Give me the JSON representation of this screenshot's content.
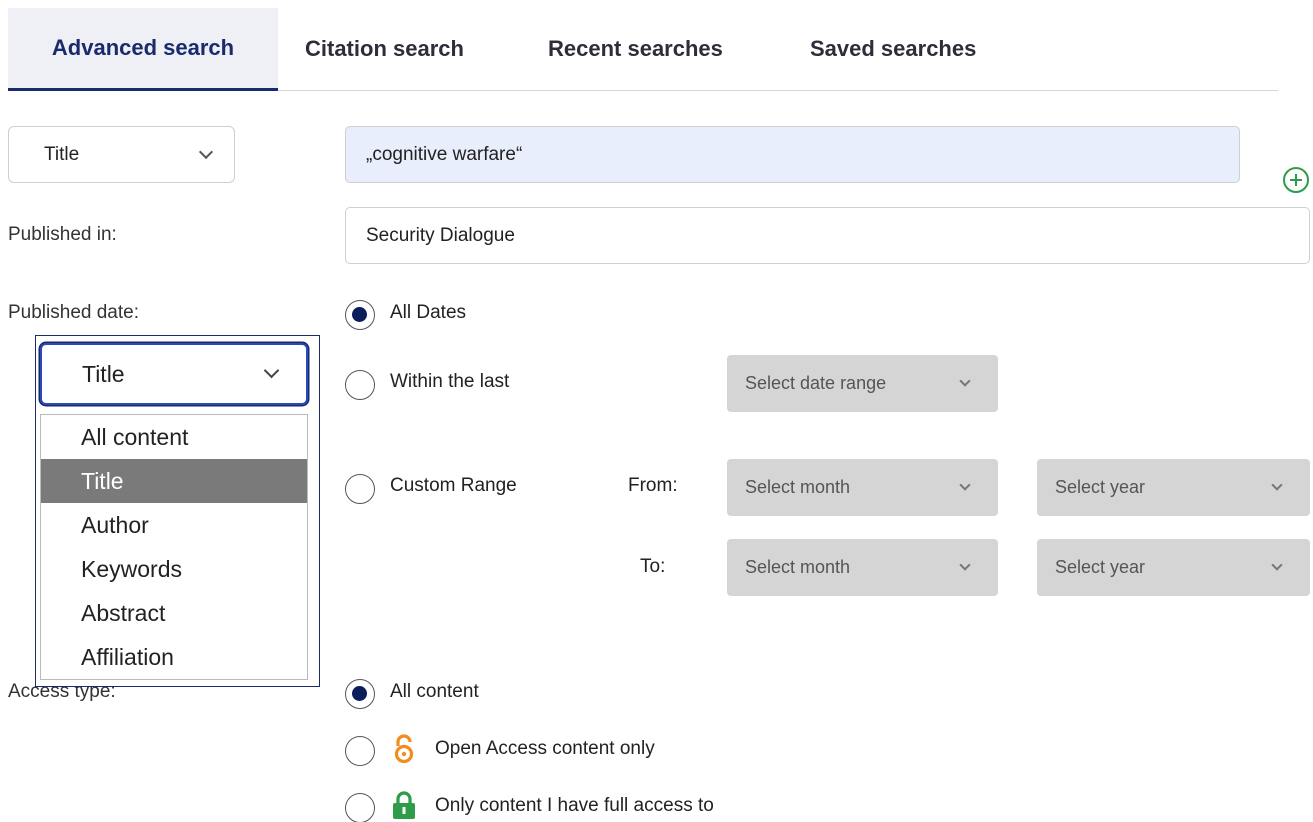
{
  "tabs": [
    {
      "label": "Advanced search",
      "active": true
    },
    {
      "label": "Citation search",
      "active": false
    },
    {
      "label": "Recent searches",
      "active": false
    },
    {
      "label": "Saved searches",
      "active": false
    }
  ],
  "search_row": {
    "field_select": "Title",
    "query_value": "„cognitive warfare“",
    "add_icon": "plus-circle-icon"
  },
  "published_in": {
    "label": "Published in:",
    "value": "Security Dialogue"
  },
  "published_date": {
    "label": "Published date:",
    "options": {
      "all_dates": "All Dates",
      "within_last": "Within the last",
      "custom_range": "Custom Range"
    },
    "selected": "All Dates",
    "date_range_placeholder": "Select date range",
    "from_label": "From:",
    "to_label": "To:",
    "month_placeholder": "Select month",
    "year_placeholder": "Select year"
  },
  "dropdown": {
    "current": "Title",
    "options": [
      "All content",
      "Title",
      "Author",
      "Keywords",
      "Abstract",
      "Affiliation"
    ],
    "highlighted": "Title"
  },
  "access_type": {
    "label": "Access type:",
    "options": {
      "all": "All content",
      "open": "Open Access content only",
      "full": "Only content I have full access to"
    },
    "selected": "All content"
  },
  "colors": {
    "accent": "#1a2a6c",
    "radio_fill": "#0c1e5a",
    "open_access": "#f28c1e",
    "full_access": "#2e9c48",
    "query_bg": "#e8eefc"
  }
}
